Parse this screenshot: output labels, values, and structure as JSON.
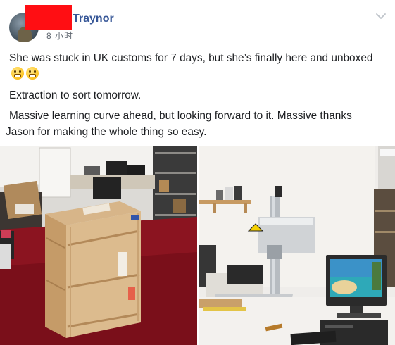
{
  "post": {
    "author": "Traynor",
    "timestamp": "8 小时",
    "paragraphs": {
      "p1": "She was stuck in UK customs for 7 days, but she’s finally here and unboxed",
      "p2": "Extraction to sort tomorrow.",
      "p3_line1": "Massive learning curve ahead, but looking forward to it. Massive thanks",
      "p3_line2": "Jason for making the whole thing so easy."
    },
    "emoji_names": [
      "grimacing-face-icon",
      "grimacing-face-icon"
    ],
    "menu_icon": "chevron-down-icon",
    "colors": {
      "author": "#385898",
      "redaction": "#ff0e13",
      "text": "#1c1e21",
      "meta": "#606770"
    },
    "photos": [
      {
        "name": "photo-wooden-crate"
      },
      {
        "name": "photo-laser-engraver"
      }
    ]
  }
}
